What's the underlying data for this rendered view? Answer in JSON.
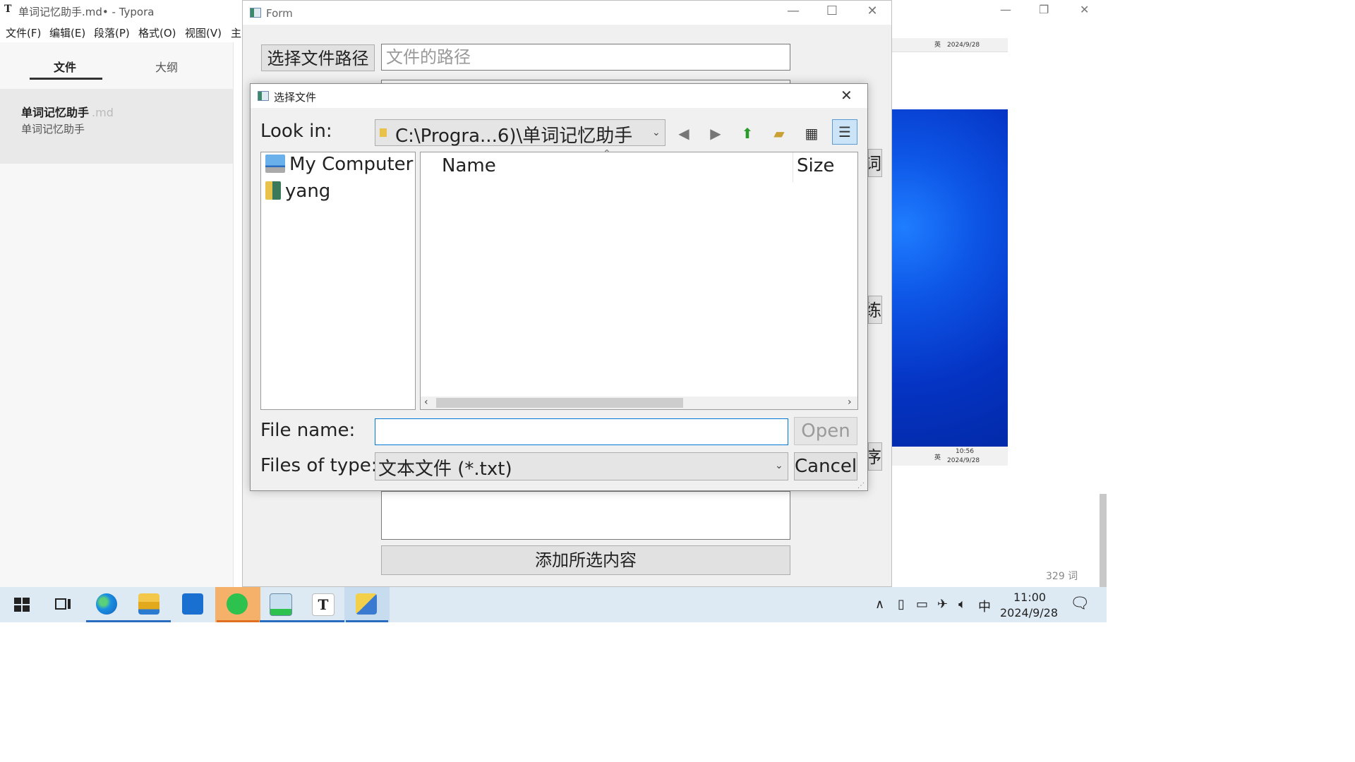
{
  "typora": {
    "title": "单词记忆助手.md• - Typora",
    "menu": [
      "文件(F)",
      "编辑(E)",
      "段落(P)",
      "格式(O)",
      "视图(V)",
      "主"
    ],
    "tabs": {
      "files": "文件",
      "outline": "大纲"
    },
    "doc": {
      "title": "单词记忆助手",
      "ext": ".md",
      "subtitle": "单词记忆助手"
    },
    "word_count": "329 词"
  },
  "preview": {
    "top_date": "2024/9/28",
    "top_tray": "英",
    "bottom_time": "10:56",
    "bottom_date": "2024/9/28",
    "bottom_tray": "英"
  },
  "form": {
    "title": "Form",
    "choose_path_label": "选择文件路径",
    "path_placeholder": "文件的路径",
    "add_selected_label": "添加所选内容",
    "side_buttons": [
      "词",
      "练",
      "序"
    ]
  },
  "dialog": {
    "title": "选择文件",
    "look_in_label": "Look in:",
    "look_in_value": "C:\\Progra...6)\\单词记忆助手",
    "tree": [
      "My Computer",
      "yang"
    ],
    "columns": {
      "name": "Name",
      "size": "Size"
    },
    "file_name_label": "File name:",
    "file_name_value": "",
    "files_of_type_label": "Files of type:",
    "files_of_type_value": "文本文件 (*.txt)",
    "open_label": "Open",
    "cancel_label": "Cancel"
  },
  "taskbar": {
    "time": "11:00",
    "date": "2024/9/28",
    "ime": "中"
  },
  "colors": {
    "accent": "#0078d7",
    "taskbar": "#dde9f3",
    "preview_blue": "#0d55e6"
  }
}
